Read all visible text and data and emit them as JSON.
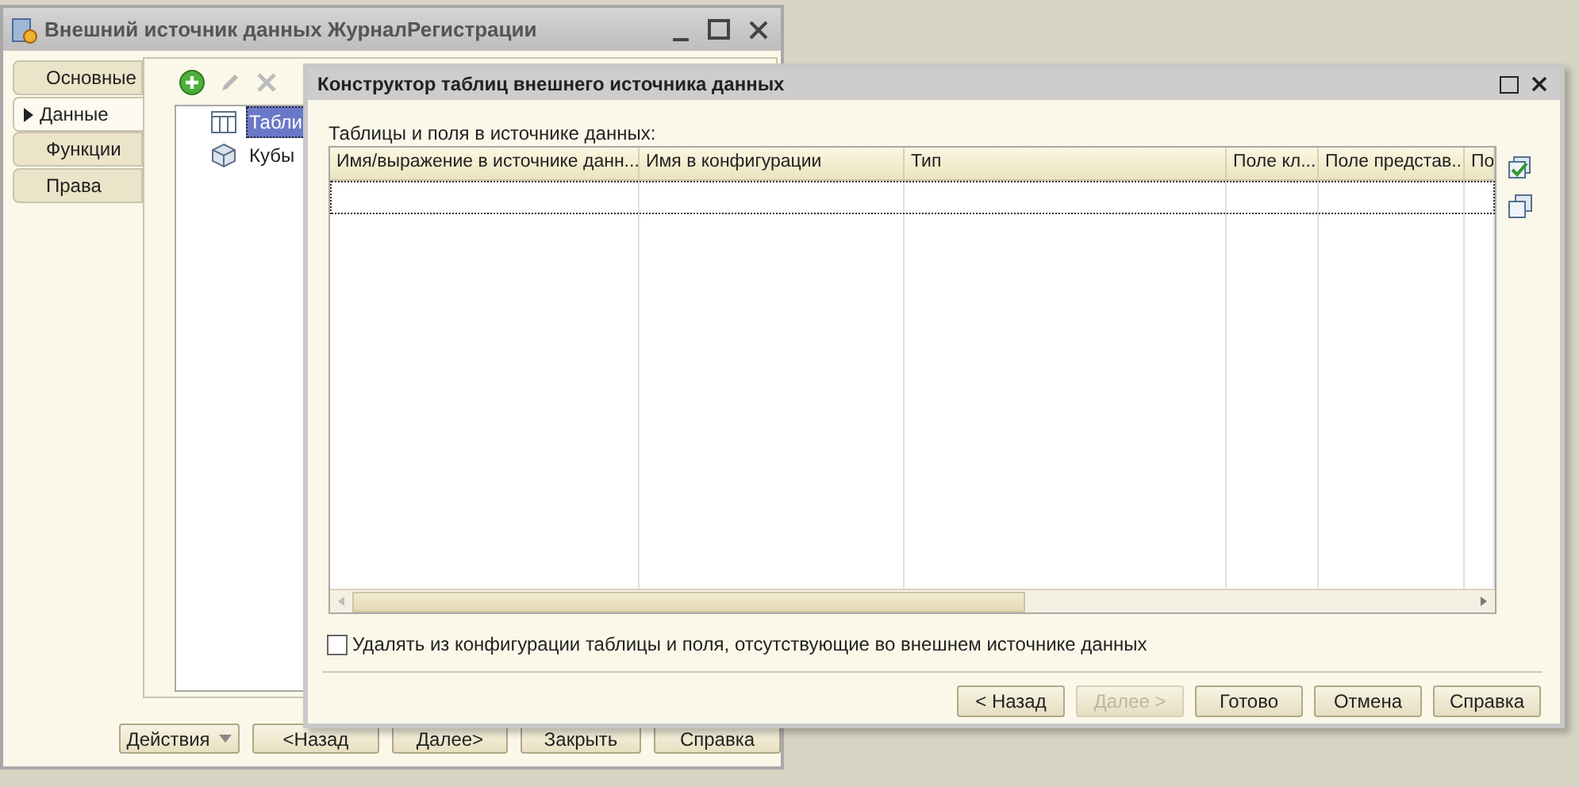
{
  "background_window": {
    "title": "Внешний источник данных ЖурналРегистрации",
    "tabs": [
      {
        "label": "Основные",
        "selected": false
      },
      {
        "label": "Данные",
        "selected": true
      },
      {
        "label": "Функции",
        "selected": false
      },
      {
        "label": "Права",
        "selected": false
      }
    ],
    "tree": [
      {
        "label": "Табли",
        "kind": "table",
        "selected": true
      },
      {
        "label": "Кубы",
        "kind": "cube",
        "selected": false
      }
    ],
    "buttons": [
      {
        "label": "Действия",
        "kind": "dropdown"
      },
      {
        "label": "<Назад",
        "kind": "plain"
      },
      {
        "label": "Далее>",
        "kind": "plain"
      },
      {
        "label": "Закрыть",
        "kind": "plain"
      },
      {
        "label": "Справка",
        "kind": "plain"
      }
    ]
  },
  "dialog": {
    "title": "Конструктор таблиц внешнего источника данных",
    "table_label": "Таблицы и поля в источнике данных:",
    "table": {
      "columns": [
        "Имя/выражение в источнике данн...",
        "Имя в конфигурации",
        "Тип",
        "Поле кл...",
        "Поле представ...",
        "По"
      ]
    },
    "checkbox": {
      "label": "Удалять из конфигурации таблицы и поля, отсутствующие во внешнем источнике данных",
      "checked": false
    },
    "buttons": [
      {
        "label": "< Назад",
        "disabled": false
      },
      {
        "label": "Далее >",
        "disabled": true
      },
      {
        "label": "Готово",
        "disabled": false
      },
      {
        "label": "Отмена",
        "disabled": false
      },
      {
        "label": "Справка",
        "disabled": false
      }
    ]
  }
}
